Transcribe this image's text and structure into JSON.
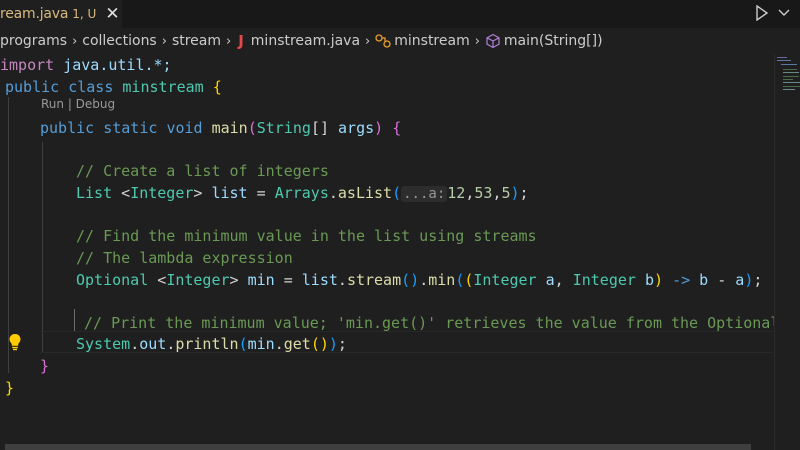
{
  "tab": {
    "title": "ream.java",
    "status": "1, U",
    "close": "✕"
  },
  "breadcrumb": {
    "items": [
      "programs",
      "collections",
      "stream"
    ],
    "file_icon": "J",
    "file": "minstream.java",
    "class": "minstream",
    "method": "main(String[])",
    "sep": "›"
  },
  "codelens": "Run | Debug",
  "code": {
    "l1": {
      "a": "import",
      "b": " java.util.*;"
    },
    "l2": {
      "a": "public",
      "b": "class",
      "c": "minstream",
      "d": "{"
    },
    "l3": {
      "a": "public",
      "b": "static",
      "c": "void",
      "d": "main",
      "e": "(",
      "f": "String",
      "g": "[]",
      "h": "args",
      "i": ")",
      "j": "{"
    },
    "l5": "// Create a list of integers",
    "l6": {
      "a": "List",
      "b": "<",
      "c": "Integer",
      "d": ">",
      "e": "list",
      "f": "=",
      "g": "Arrays",
      "h": ".",
      "i": "asList",
      "j": "(",
      "k": "...a:",
      "l": "12",
      "m": ",",
      "n": "53",
      "o": ",",
      "p": "5",
      "q": ")",
      "r": ";"
    },
    "l8": "// Find the minimum value in the list using streams",
    "l9": "// The lambda expression",
    "l10": {
      "a": "Optional",
      "b": "<",
      "c": "Integer",
      "d": ">",
      "e": "min",
      "f": "=",
      "g": "list",
      "h": ".",
      "i": "stream",
      "j": "()",
      "k": ".",
      "l": "min",
      "m": "(",
      "n": "(",
      "o": "Integer",
      "p": "a",
      "q": ",",
      "r": "Integer",
      "s": "b",
      "t": ")",
      "u": "->",
      "v": "b",
      "w": "-",
      "x": "a",
      "y": ")",
      "z": ";"
    },
    "l12": "// Print the minimum value; 'min.get()' retrieves the value from the Optional",
    "l13": {
      "a": "System",
      "b": ".",
      "c": "out",
      "d": ".",
      "e": "println",
      "f": "(",
      "g": "min",
      "h": ".",
      "i": "get",
      "j": "()",
      "k": ")",
      "l": ";"
    },
    "l14": "}",
    "l15": "}"
  },
  "colors": {
    "background": "#1f1f1f",
    "keyword": "#569cd6",
    "type": "#4ec9b0",
    "comment": "#6a9955",
    "tab_modified": "#d7ba7d",
    "java_icon": "#e8484a"
  },
  "icons": [
    "close-icon",
    "run-icon",
    "chevron-down-icon",
    "java-file-icon",
    "class-icon",
    "method-icon",
    "lightbulb-icon"
  ]
}
